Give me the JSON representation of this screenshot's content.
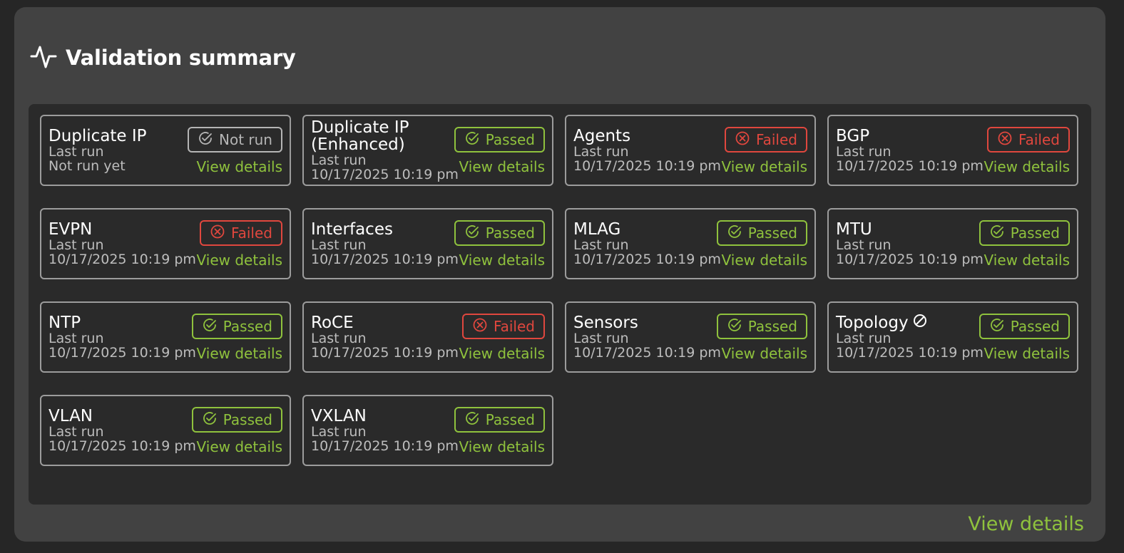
{
  "header": {
    "title": "Validation summary",
    "icon": "activity-icon"
  },
  "colors": {
    "passed": "#8fc23d",
    "failed": "#e0473e",
    "not_run": "#b5b5b5"
  },
  "cards": [
    {
      "name": "Duplicate IP",
      "sub": "Last run",
      "time": "Not run yet",
      "status": "Not run",
      "kind": "notrun",
      "link": "View details"
    },
    {
      "name": "Duplicate IP (Enhanced)",
      "sub": "Last run",
      "time": "10/17/2025 10:19 pm",
      "status": "Passed",
      "kind": "passed",
      "link": "View details"
    },
    {
      "name": "Agents",
      "sub": "Last run",
      "time": "10/17/2025 10:19 pm",
      "status": "Failed",
      "kind": "failed",
      "link": "View details"
    },
    {
      "name": "BGP",
      "sub": "Last run",
      "time": "10/17/2025 10:19 pm",
      "status": "Failed",
      "kind": "failed",
      "link": "View details"
    },
    {
      "name": "EVPN",
      "sub": "Last run",
      "time": "10/17/2025 10:19 pm",
      "status": "Failed",
      "kind": "failed",
      "link": "View details"
    },
    {
      "name": "Interfaces",
      "sub": "Last run",
      "time": "10/17/2025 10:19 pm",
      "status": "Passed",
      "kind": "passed",
      "link": "View details"
    },
    {
      "name": "MLAG",
      "sub": "Last run",
      "time": "10/17/2025 10:19 pm",
      "status": "Passed",
      "kind": "passed",
      "link": "View details"
    },
    {
      "name": "MTU",
      "sub": "Last run",
      "time": "10/17/2025 10:19 pm",
      "status": "Passed",
      "kind": "passed",
      "link": "View details"
    },
    {
      "name": "NTP",
      "sub": "Last run",
      "time": "10/17/2025 10:19 pm",
      "status": "Passed",
      "kind": "passed",
      "link": "View details"
    },
    {
      "name": "RoCE",
      "sub": "Last run",
      "time": "10/17/2025 10:19 pm",
      "status": "Failed",
      "kind": "failed",
      "link": "View details"
    },
    {
      "name": "Sensors",
      "sub": "Last run",
      "time": "10/17/2025 10:19 pm",
      "status": "Passed",
      "kind": "passed",
      "link": "View details"
    },
    {
      "name": "Topology",
      "sub": "Last run",
      "time": "10/17/2025 10:19 pm",
      "status": "Passed",
      "kind": "passed",
      "link": "View details",
      "extra_icon": "disabled-icon"
    },
    {
      "name": "VLAN",
      "sub": "Last run",
      "time": "10/17/2025 10:19 pm",
      "status": "Passed",
      "kind": "passed",
      "link": "View details"
    },
    {
      "name": "VXLAN",
      "sub": "Last run",
      "time": "10/17/2025 10:19 pm",
      "status": "Passed",
      "kind": "passed",
      "link": "View details"
    }
  ],
  "footer": {
    "link": "View details"
  }
}
